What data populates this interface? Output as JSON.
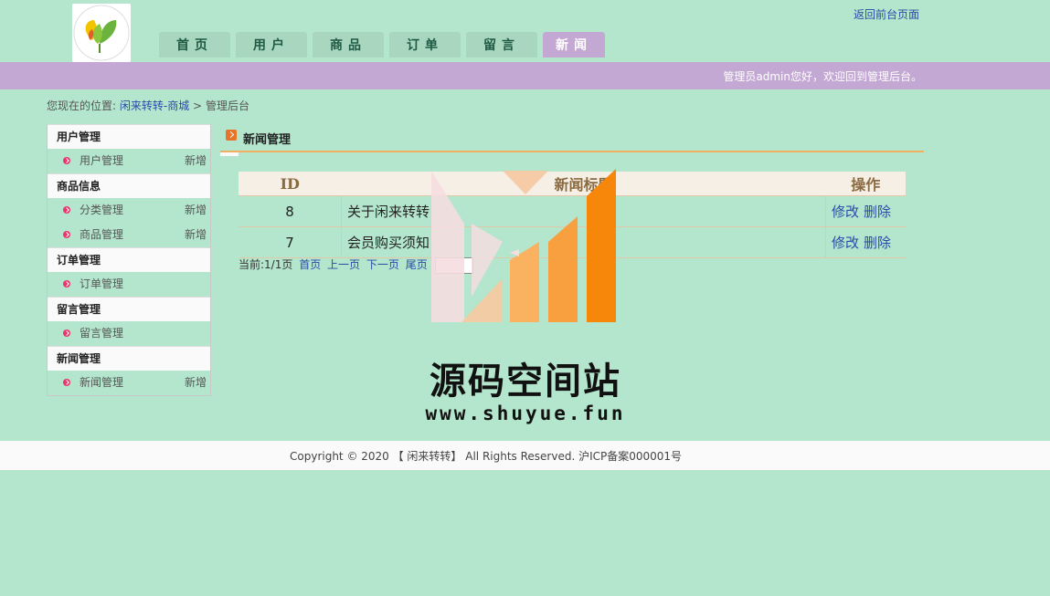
{
  "header": {
    "back_link": "返回前台页面",
    "welcome": "管理员admin您好，欢迎回到管理后台。"
  },
  "nav": {
    "tabs": [
      {
        "label": "首页"
      },
      {
        "label": "用户"
      },
      {
        "label": "商品"
      },
      {
        "label": "订单"
      },
      {
        "label": "留言"
      },
      {
        "label": "新闻",
        "active": true
      }
    ]
  },
  "breadcrumb": {
    "prefix": "您现在的位置:",
    "link": "闲来转转-商城",
    "sep": ">",
    "current": "管理后台"
  },
  "sidebar": {
    "sections": [
      {
        "title": "用户管理",
        "items": [
          {
            "label": "用户管理",
            "action": "新增"
          }
        ]
      },
      {
        "title": "商品信息",
        "items": [
          {
            "label": "分类管理",
            "action": "新增"
          },
          {
            "label": "商品管理",
            "action": "新增"
          }
        ]
      },
      {
        "title": "订单管理",
        "items": [
          {
            "label": "订单管理",
            "action": ""
          }
        ]
      },
      {
        "title": "留言管理",
        "items": [
          {
            "label": "留言管理",
            "action": ""
          }
        ]
      },
      {
        "title": "新闻管理",
        "items": [
          {
            "label": "新闻管理",
            "action": "新增"
          }
        ]
      }
    ]
  },
  "panel": {
    "title": "新闻管理"
  },
  "table": {
    "headers": [
      "ID",
      "新闻标题",
      "操作"
    ],
    "rows": [
      {
        "id": "8",
        "title": "关于闲来转转",
        "edit": "修改",
        "delete": "删除"
      },
      {
        "id": "7",
        "title": "会员购买须知",
        "edit": "修改",
        "delete": "删除"
      }
    ]
  },
  "pager": {
    "info": "当前:1/1页",
    "first": "首页",
    "prev": "上一页",
    "next": "下一页",
    "last": "尾页"
  },
  "watermark": {
    "title": "源码空间站",
    "url": "www.shuyue.fun"
  },
  "footer": {
    "copyright": "Copyright © 2020 【 闲来转转】 All Rights Reserved. 沪ICP备案000001号"
  }
}
